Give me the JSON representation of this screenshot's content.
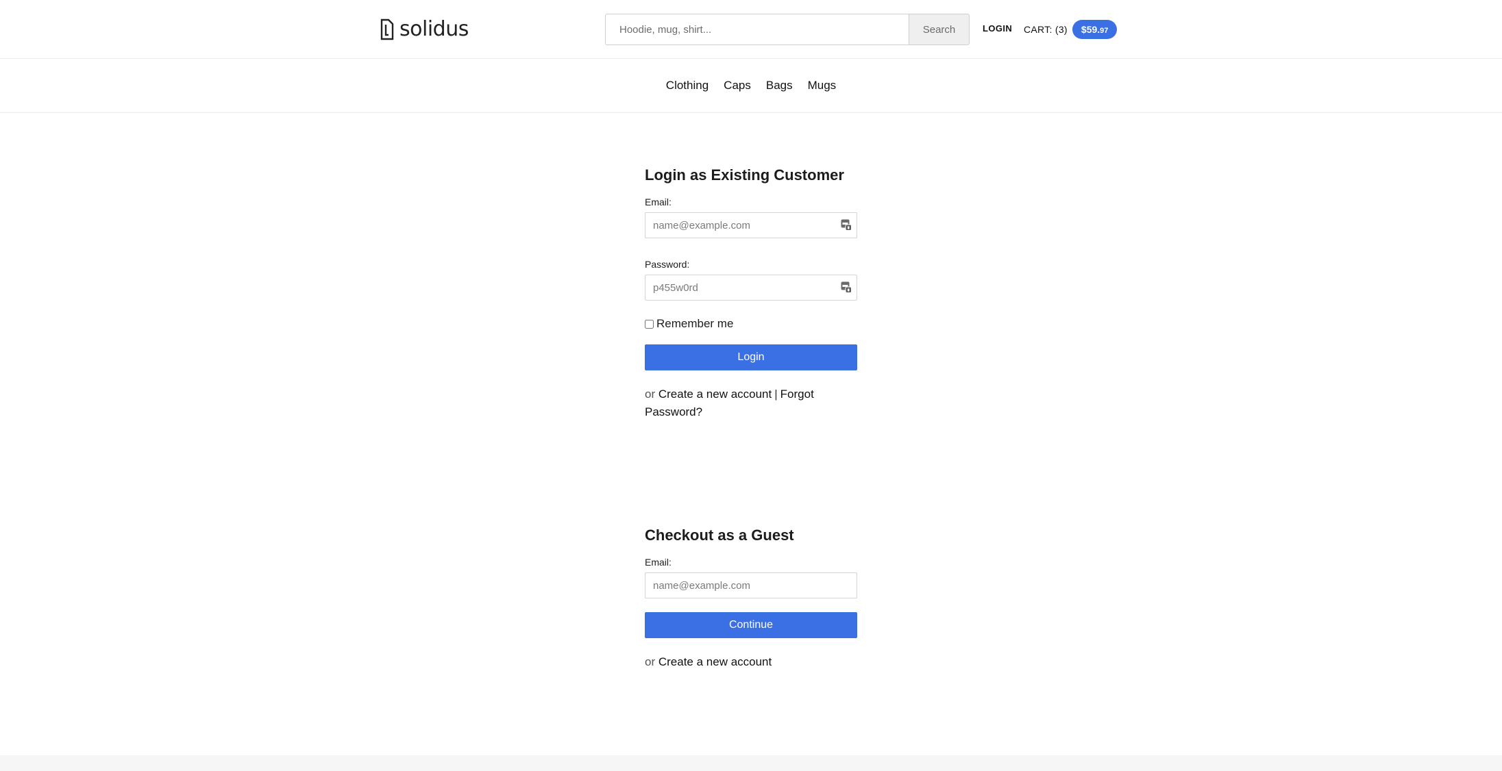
{
  "brand": {
    "name": "solidus",
    "logo_icon": "solidus-logo-mark"
  },
  "search": {
    "placeholder": "Hoodie, mug, shirt...",
    "button_label": "Search",
    "icon": "none"
  },
  "account": {
    "login_label": "LOGIN"
  },
  "cart": {
    "label": "CART: (3)",
    "total_main": "$59.",
    "total_cents": "97",
    "badge_color": "#3b6fe4"
  },
  "categories": [
    {
      "label": "Clothing"
    },
    {
      "label": "Caps"
    },
    {
      "label": "Bags"
    },
    {
      "label": "Mugs"
    }
  ],
  "login": {
    "title": "Login as Existing Customer",
    "email_label": "Email:",
    "email_placeholder": "name@example.com",
    "password_label": "Password:",
    "password_placeholder": "p455w0rd",
    "remember_label": "Remember me",
    "submit_label": "Login",
    "links_prefix": "or",
    "create_account_label": "Create a new account",
    "separator": "|",
    "forgot_password_label": "Forgot Password?",
    "field_icon": "password-manager-icon"
  },
  "guest": {
    "title": "Checkout as a Guest",
    "email_label": "Email:",
    "email_placeholder": "name@example.com",
    "submit_label": "Continue",
    "links_prefix": "or",
    "create_account_label": "Create a new account"
  },
  "colors": {
    "accent": "#3b6fe4",
    "divider": "#ececec",
    "text": "#1c1c1c"
  }
}
